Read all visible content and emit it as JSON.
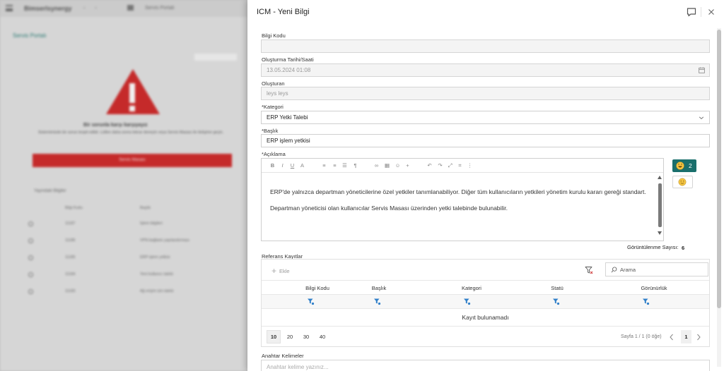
{
  "panel": {
    "title": "ICM - Yeni Bilgi"
  },
  "form": {
    "bilgi_kodu": {
      "label": "Bilgi Kodu",
      "value": ""
    },
    "olusturma_tarihi": {
      "label": "Oluşturma Tarihi/Saati",
      "value": "13.05.2024 01:08"
    },
    "olusturan": {
      "label": "Oluşturan",
      "value": "leys leys"
    },
    "kategori": {
      "label": "*Kategori",
      "value": "ERP Yetki Talebi"
    },
    "baslik": {
      "label": "*Başlık",
      "value": "ERP işlem yetkisi"
    },
    "aciklama": {
      "label": "*Açıklama",
      "paragraphs": [
        "ERP'de yalnızca departman yöneticilerine özel yetkiler tanımlanabiliyor. Diğer tüm kullanıcıların yetkileri yönetim kurulu kararı gereği standart.",
        "Departman yöneticisi olan kullanıcılar Servis Masası üzerinden yetki talebinde bulunabilir."
      ]
    }
  },
  "reactions": {
    "count": "2"
  },
  "views": {
    "label": "Görüntülenme Sayısı:",
    "value": "6"
  },
  "references": {
    "label": "Referans Kayıtlar",
    "add_label": "Ekle",
    "search_placeholder": "Arama",
    "columns": [
      "Bilgi Kodu",
      "Başlık",
      "Kategori",
      "Statü",
      "Görünürlük"
    ],
    "empty_text": "Kayıt bulunamadı",
    "page_sizes": [
      "10",
      "20",
      "30",
      "40"
    ],
    "page_info": "Sayfa 1 / 1 (0 öğe)",
    "current_page": "1"
  },
  "keywords": {
    "label": "Anahtar Kelimeler",
    "placeholder": "Anahtar kelime yazınız..."
  },
  "background": {
    "brand": "Bimserlsynergy",
    "breadcrumb": "Servis Portalı",
    "page_title": "Servis Portalı",
    "error_title": "Bir sorunla karşı karşıyayız",
    "error_text": "Sistemimizde bir sorun tespit edildi. Lütfen daha sonra tekrar deneyin veya Servis Masası ile iletişime geçin.",
    "error_button": "Servis Masası",
    "section_title": "Yayındaki Bilgiler",
    "col_a": "Bilgi Kodu",
    "col_b": "Başlık",
    "rows": [
      {
        "code": "11187",
        "title": "İşlem bilgileri"
      },
      {
        "code": "11186",
        "title": "VPN bağlantı yapılandırması"
      },
      {
        "code": "11185",
        "title": "ERP işlem yetkisi"
      },
      {
        "code": "11184",
        "title": "Yeni kullanıcı talebi"
      },
      {
        "code": "11183",
        "title": "Ağ erişim izin talebi"
      }
    ]
  },
  "colors": {
    "accent": "#1a6f6c",
    "danger": "#c52a2a"
  }
}
